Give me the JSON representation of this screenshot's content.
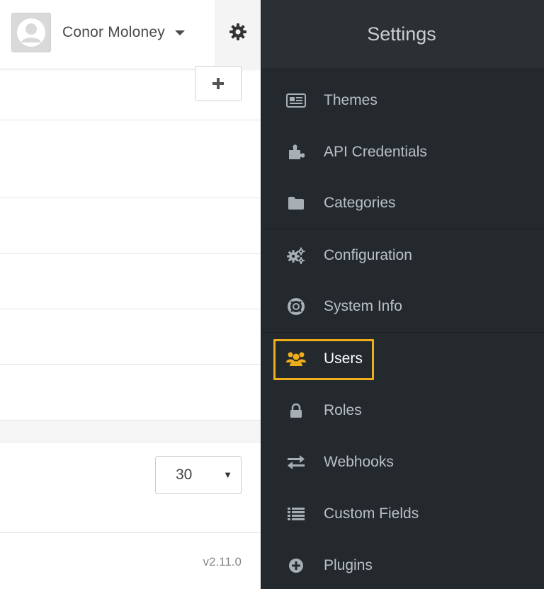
{
  "header": {
    "user_name": "Conor Moloney"
  },
  "list": {
    "page_size": "30"
  },
  "footer": {
    "version": "v2.11.0"
  },
  "settings": {
    "title": "Settings",
    "active_item": "Users",
    "highlight_color": "#f0ad1b",
    "items": [
      {
        "label": "Themes",
        "icon": "newspaper-icon"
      },
      {
        "label": "API Credentials",
        "icon": "puzzle-icon"
      },
      {
        "label": "Categories",
        "icon": "folder-icon"
      },
      {
        "label": "Configuration",
        "icon": "cogs-icon"
      },
      {
        "label": "System Info",
        "icon": "life-ring-icon"
      },
      {
        "label": "Users",
        "icon": "users-icon"
      },
      {
        "label": "Roles",
        "icon": "lock-icon"
      },
      {
        "label": "Webhooks",
        "icon": "exchange-icon"
      },
      {
        "label": "Custom Fields",
        "icon": "list-icon"
      },
      {
        "label": "Plugins",
        "icon": "plus-circle-icon"
      }
    ]
  }
}
